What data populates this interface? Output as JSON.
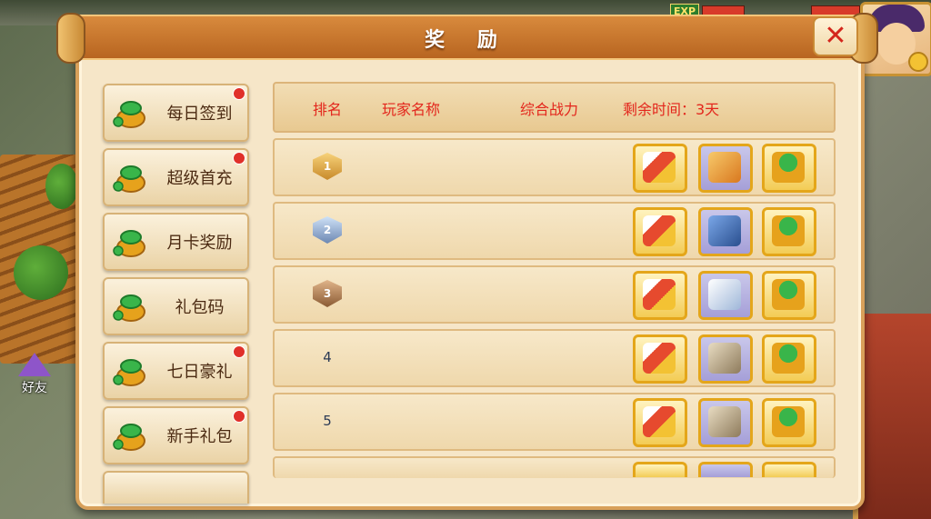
{
  "window": {
    "title": "奖 励"
  },
  "hud": {
    "exp_label": "EXP",
    "friend_label": "好友"
  },
  "menu": [
    {
      "label": "每日签到",
      "badge": true
    },
    {
      "label": "超级首充",
      "badge": true
    },
    {
      "label": "月卡奖励",
      "badge": false
    },
    {
      "label": "礼包码",
      "badge": false
    },
    {
      "label": "七日豪礼",
      "badge": true
    },
    {
      "label": "新手礼包",
      "badge": true
    }
  ],
  "table": {
    "headers": {
      "rank": "排名",
      "player": "玩家名称",
      "power": "综合战力",
      "time_left": "剩余时间：3天"
    },
    "rows": [
      {
        "rank": "1",
        "rewards": [
          "scroll-icon",
          "dragon-icon",
          "money-bag-icon"
        ]
      },
      {
        "rank": "2",
        "rewards": [
          "scroll-icon",
          "blue-beast-icon",
          "money-bag-icon"
        ]
      },
      {
        "rank": "3",
        "rewards": [
          "scroll-icon",
          "white-wolf-icon",
          "money-bag-icon"
        ]
      },
      {
        "rank": "4",
        "rewards": [
          "scroll-icon",
          "stone-beast-icon",
          "money-bag-icon"
        ]
      },
      {
        "rank": "5",
        "rewards": [
          "scroll-icon",
          "stone-beast-icon",
          "money-bag-icon"
        ]
      }
    ]
  },
  "colors": {
    "header_text": "#e3261c",
    "panel_bg": "#f6e6c8",
    "title_bar": "#c8752c",
    "badge_red": "#e0302a"
  }
}
